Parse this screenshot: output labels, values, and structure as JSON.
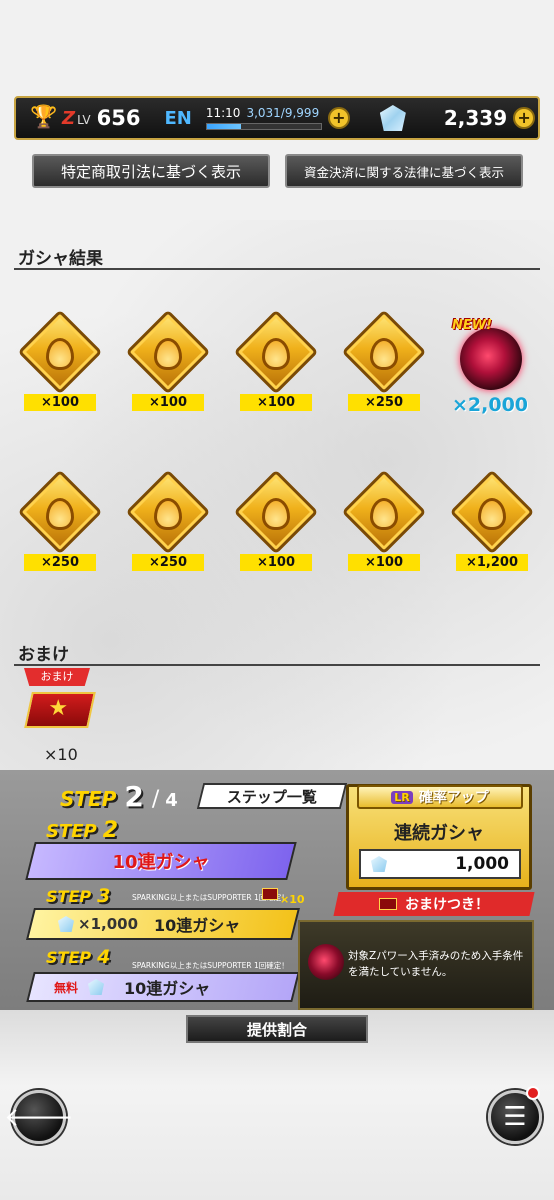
{
  "status": {
    "z_mark": "Z",
    "lv_label": "LV",
    "level": "656",
    "en_label": "EN",
    "en_time": "11:10",
    "en_count": "3,031/9,999",
    "en_fraction": 0.303,
    "gems": "2,339",
    "plus": "+"
  },
  "legal": {
    "button1": "特定商取引法に基づく表示",
    "button2": "資金決済に関する法律に基づく表示"
  },
  "results": {
    "title": "ガシャ結果",
    "row1": [
      {
        "amount": "×100",
        "icon": "gold-medal-icon"
      },
      {
        "amount": "×100",
        "icon": "gold-medal-icon"
      },
      {
        "amount": "×100",
        "icon": "gold-medal-icon"
      },
      {
        "amount": "×250",
        "icon": "gold-medal-icon"
      }
    ],
    "character": {
      "badge": "NEW!",
      "amount": "×2,000",
      "icon": "character-portrait-icon"
    },
    "row2": [
      {
        "amount": "×250",
        "icon": "gold-medal-icon"
      },
      {
        "amount": "×250",
        "icon": "gold-medal-icon"
      },
      {
        "amount": "×100",
        "icon": "gold-medal-icon"
      },
      {
        "amount": "×100",
        "icon": "gold-medal-icon"
      },
      {
        "amount": "×1,200",
        "icon": "gold-medal-icon"
      }
    ]
  },
  "omake": {
    "title": "おまけ",
    "tag": "おまけ",
    "count": "×10"
  },
  "steps": {
    "word": "STEP",
    "current": "2",
    "sep": "/",
    "total": "4",
    "list_button": "ステップ一覧",
    "step2": {
      "num": "2",
      "label": "10連ガシャ"
    },
    "step3": {
      "num": "3",
      "note": "SPARKING以上またはSUPPORTER 1回確定！",
      "bonus": "×10",
      "price": "×1,000",
      "label": "10連ガシャ"
    },
    "step4": {
      "num": "4",
      "note": "SPARKING以上またはSUPPORTER 1回確定！",
      "free": "無料",
      "label": "10連ガシャ"
    }
  },
  "rateup": {
    "lr": "LR",
    "head": "確率アップ",
    "title": "連続ガシャ",
    "price": "1,000",
    "omake_label": "おまけつき！",
    "notice": "対象Zパワー入手済みのため入手条件を満たしていません。"
  },
  "rate_button": "提供割合",
  "nav": {
    "back_icon": "🡐",
    "menu_icon": "☰"
  },
  "colors": {
    "accent_yellow": "#ffe000",
    "step2_purple": "#8a6cf0",
    "step3_yellow": "#ffd400",
    "cyan_amount": "#1aa5d8"
  }
}
